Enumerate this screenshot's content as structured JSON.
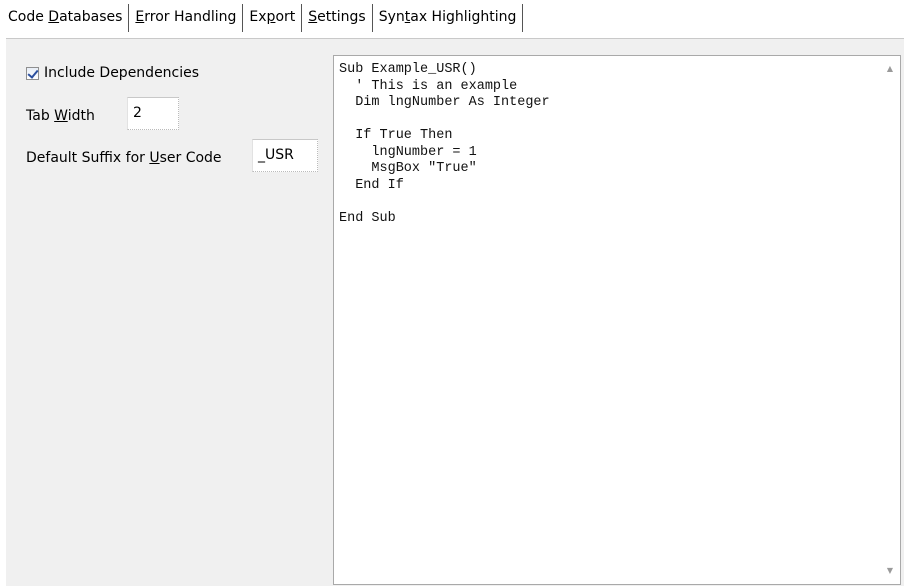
{
  "tabs": [
    {
      "label_pre": "Code ",
      "label_u": "D",
      "label_post": "atabases"
    },
    {
      "label_pre": "",
      "label_u": "E",
      "label_post": "rror Handling"
    },
    {
      "label_pre": "Ex",
      "label_u": "p",
      "label_post": "ort"
    },
    {
      "label_pre": "",
      "label_u": "S",
      "label_post": "ettings"
    },
    {
      "label_pre": "Syn",
      "label_u": "t",
      "label_post": "ax Highlighting"
    }
  ],
  "active_tab_index": 2,
  "export": {
    "include_dependencies": {
      "label": "Include Dependencies",
      "checked": true
    },
    "tab_width": {
      "label_pre": "Tab ",
      "label_u": "W",
      "label_post": "idth",
      "value": "2"
    },
    "default_suffix": {
      "label_pre": "Default Suffix for ",
      "label_u": "U",
      "label_post": "ser Code",
      "value": "_USR"
    }
  },
  "preview": {
    "code": "Sub Example_USR()\n  ' This is an example\n  Dim lngNumber As Integer\n\n  If True Then\n    lngNumber = 1\n    MsgBox \"True\"\n  End If\n\nEnd Sub",
    "scroll_up_icon": "scroll-up-arrow-icon",
    "scroll_down_icon": "scroll-down-arrow-icon"
  }
}
